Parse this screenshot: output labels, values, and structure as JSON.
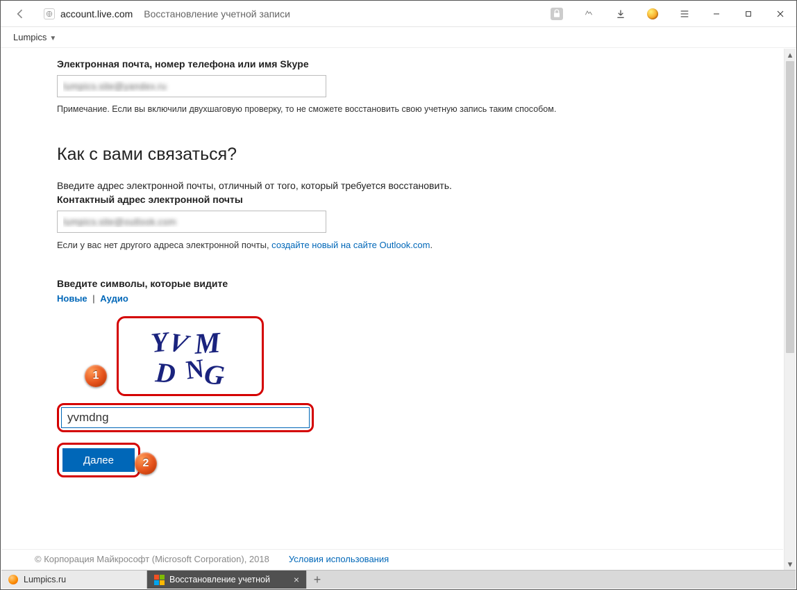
{
  "browser": {
    "url_host": "account.live.com",
    "url_title": "Восстановление учетной записи",
    "bookmark": "Lumpics"
  },
  "form": {
    "section1_label": "Электронная почта, номер телефона или имя Skype",
    "email_value": "lumpics.site@yandex.ru",
    "note": "Примечание. Если вы включили двухшаговую проверку, то не сможете восстановить свою учетную запись таким способом.",
    "heading": "Как с вами связаться?",
    "contact_desc": "Введите адрес электронной почты, отличный от того, который требуется восстановить.",
    "contact_label": "Контактный адрес электронной почты",
    "contact_value": "lumpics.site@outlook.com",
    "no_email_prefix": "Если у вас нет другого адреса электронной почты, ",
    "no_email_link": "создайте новый на сайте Outlook.com",
    "no_email_suffix": ".",
    "captcha_label": "Введите символы, которые видите",
    "captcha_new": "Новые",
    "captcha_audio": "Аудио",
    "captcha_text_line1": "YVM",
    "captcha_text_line2": "DNG",
    "captcha_input_value": "yvmdng",
    "next_button": "Далее"
  },
  "annotations": {
    "badge1": "1",
    "badge2": "2"
  },
  "footer": {
    "copyright": "© Корпорация Майкрософт (Microsoft Corporation), 2018",
    "terms": "Условия использования"
  },
  "tabs": {
    "tab1": "Lumpics.ru",
    "tab2": "Восстановление учетной"
  }
}
